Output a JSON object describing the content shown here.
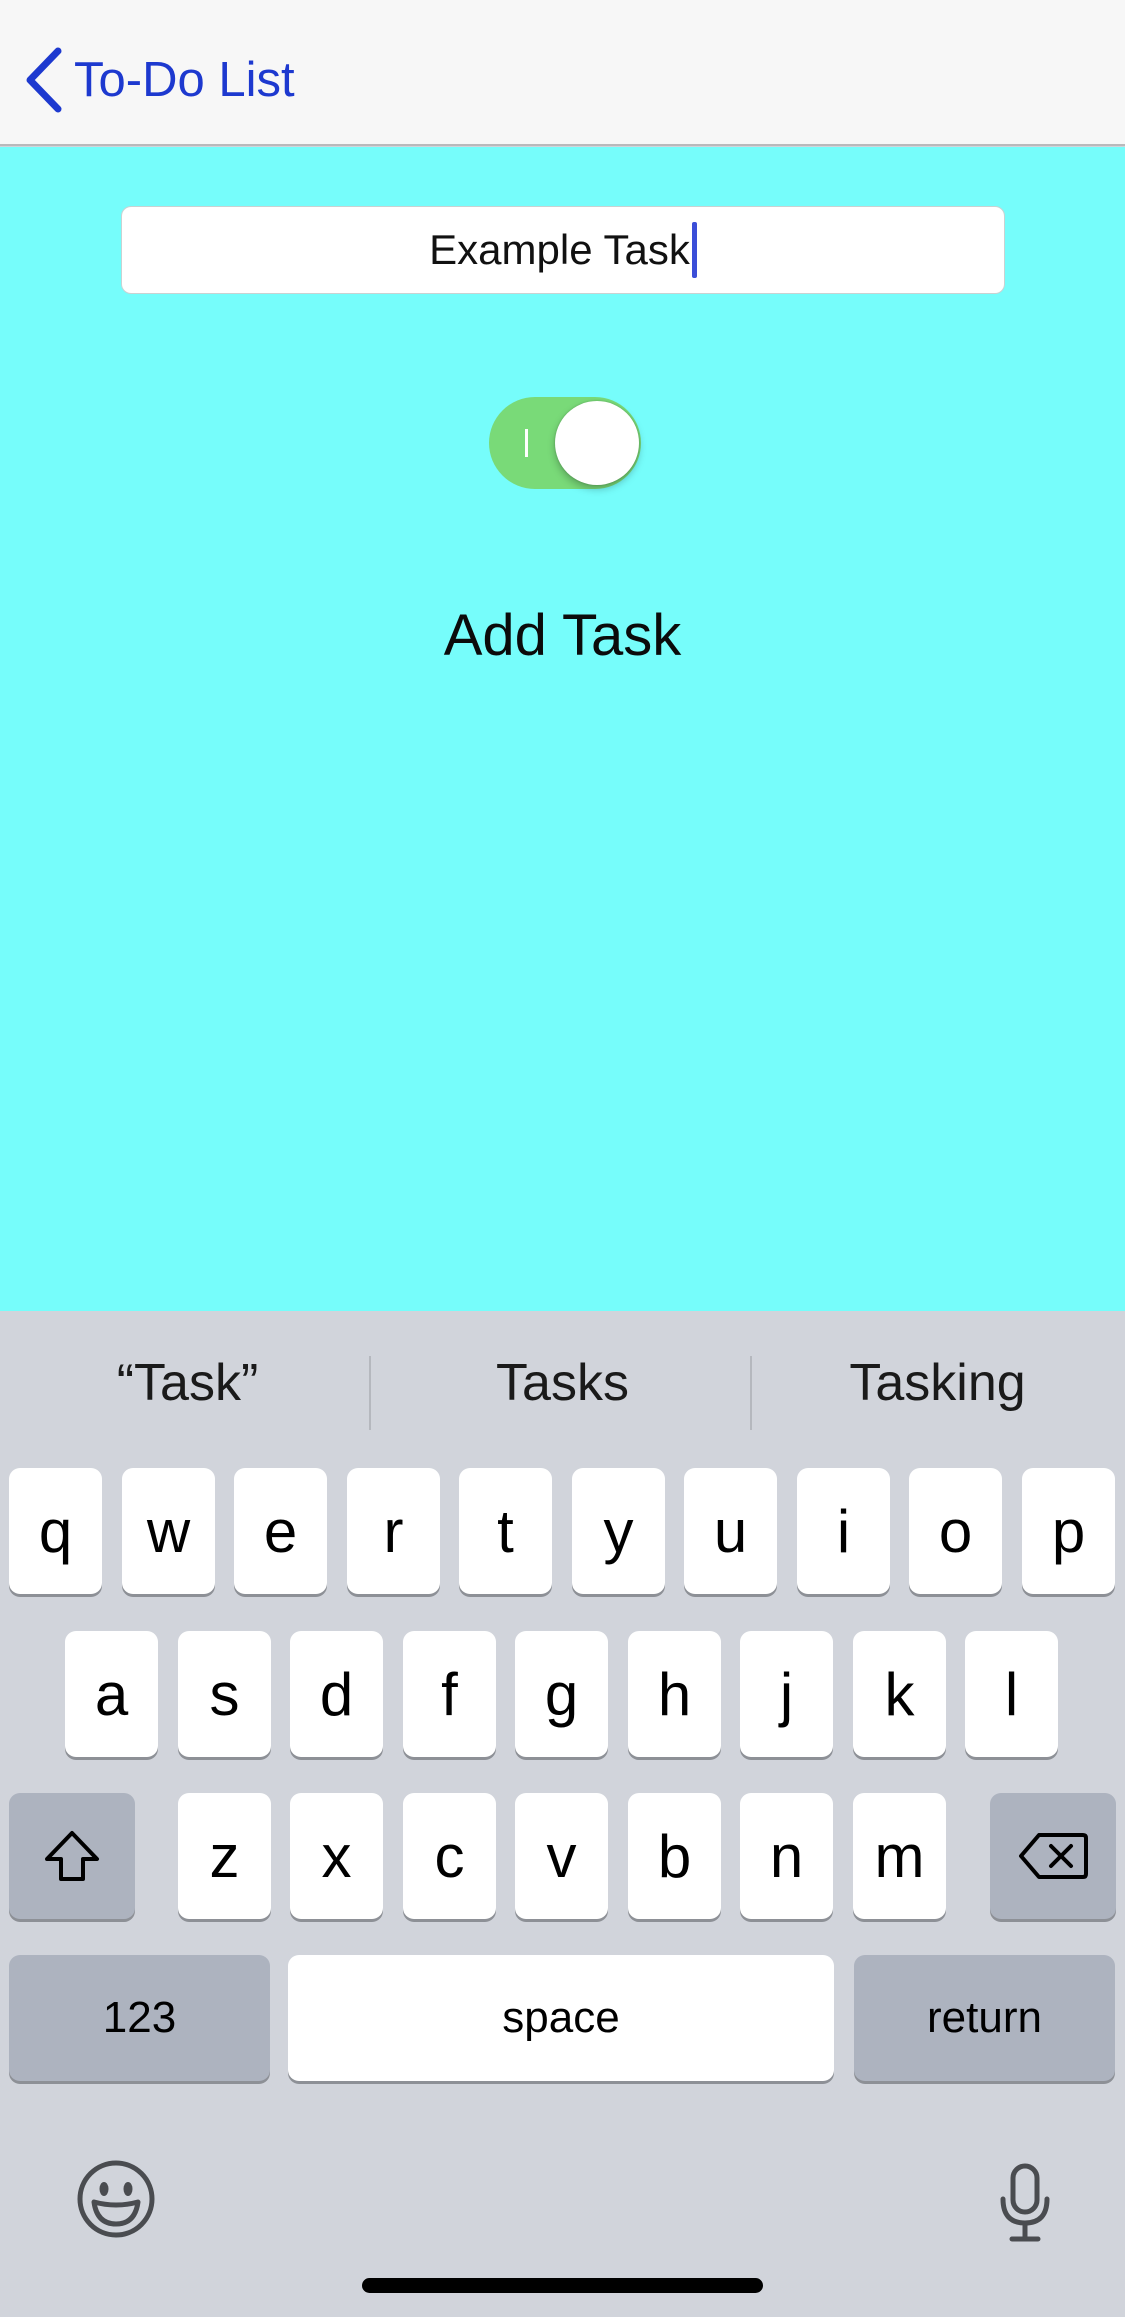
{
  "nav": {
    "back_label": "To-Do List"
  },
  "form": {
    "task_value": "Example Task",
    "toggle_on": true,
    "add_button_label": "Add Task"
  },
  "keyboard": {
    "suggestions": [
      "“Task”",
      "Tasks",
      "Tasking"
    ],
    "row1": [
      "q",
      "w",
      "e",
      "r",
      "t",
      "y",
      "u",
      "i",
      "o",
      "p"
    ],
    "row2": [
      "a",
      "s",
      "d",
      "f",
      "g",
      "h",
      "j",
      "k",
      "l"
    ],
    "row3": [
      "z",
      "x",
      "c",
      "v",
      "b",
      "n",
      "m"
    ],
    "numbers_label": "123",
    "space_label": "space",
    "return_label": "return"
  },
  "colors": {
    "accent": "#1d39cf",
    "background": "#76fdfb",
    "toggle_on": "#79da78"
  },
  "icons": {
    "back": "chevron-left-icon",
    "shift": "shift-icon",
    "delete": "delete-icon",
    "emoji": "emoji-icon",
    "mic": "microphone-icon"
  }
}
